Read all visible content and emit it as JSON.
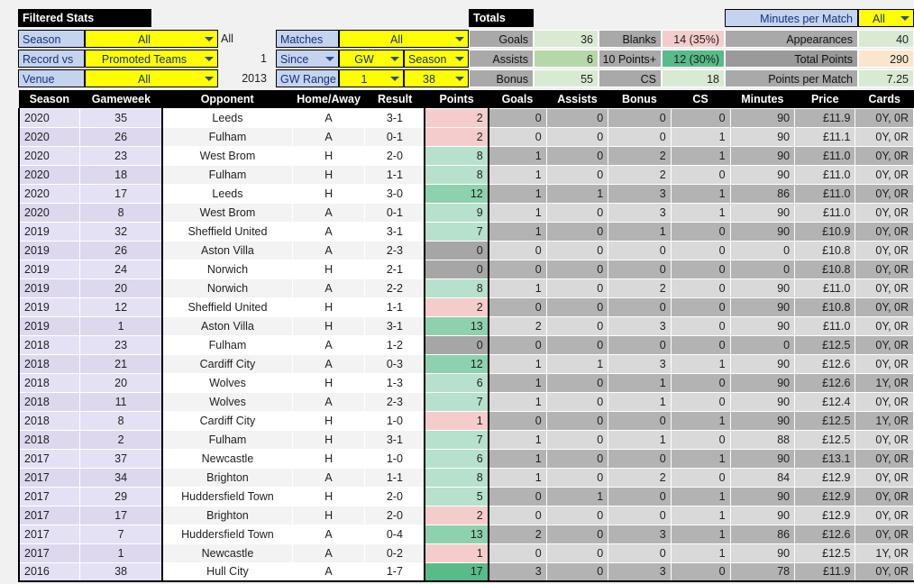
{
  "filters": {
    "title": "Filtered Stats",
    "rows": [
      {
        "label": "Season",
        "value": "All",
        "side": "All"
      },
      {
        "label": "Record vs",
        "value": "Promoted Teams",
        "side": "1"
      },
      {
        "label": "Venue",
        "value": "All",
        "side": "2013"
      }
    ]
  },
  "matches": {
    "rows": [
      {
        "label": "Matches",
        "v1": "All",
        "v2": null
      },
      {
        "label": "Since",
        "v1": "GW",
        "v2": "Season",
        "label_has_caret": true
      },
      {
        "label": "GW Range",
        "v1": "1",
        "v2": "38"
      }
    ]
  },
  "totals": {
    "title": "Totals",
    "left": [
      {
        "label": "Goals",
        "value": "36"
      },
      {
        "label": "Assists",
        "value": "6"
      },
      {
        "label": "Bonus",
        "value": "55"
      }
    ],
    "right": [
      {
        "label": "Blanks",
        "value": "14 (35%)"
      },
      {
        "label": "10 Points+",
        "value": "12 (30%)"
      },
      {
        "label": "CS",
        "value": "18"
      }
    ]
  },
  "summary": {
    "dropdown_label": "Minutes per Match",
    "dropdown_value": "All",
    "rows": [
      {
        "label": "Appearances",
        "value": "40"
      },
      {
        "label": "Total Points",
        "value": "290"
      },
      {
        "label": "Points per Match",
        "value": "7.25"
      }
    ]
  },
  "table": {
    "columns": [
      "Season",
      "Gameweek",
      "Opponent",
      "Home/Away",
      "Result",
      "Points",
      "Goals",
      "Assists",
      "Bonus",
      "CS",
      "Minutes",
      "Price",
      "Cards"
    ],
    "rows": [
      {
        "season": "2020",
        "gameweek": "35",
        "opponent": "Leeds",
        "home_away": "A",
        "result": "3-1",
        "points": "2",
        "points_tier": "low",
        "goals": "0",
        "assists": "0",
        "bonus": "0",
        "cs": "0",
        "minutes": "90",
        "price": "£11.9",
        "cards": "0Y, 0R"
      },
      {
        "season": "2020",
        "gameweek": "26",
        "opponent": "Fulham",
        "home_away": "A",
        "result": "0-1",
        "points": "2",
        "points_tier": "low",
        "goals": "0",
        "assists": "0",
        "bonus": "0",
        "cs": "1",
        "minutes": "90",
        "price": "£11.1",
        "cards": "0Y, 0R"
      },
      {
        "season": "2020",
        "gameweek": "23",
        "opponent": "West Brom",
        "home_away": "H",
        "result": "2-0",
        "points": "8",
        "points_tier": "mid",
        "goals": "1",
        "assists": "0",
        "bonus": "2",
        "cs": "1",
        "minutes": "90",
        "price": "£11.0",
        "cards": "0Y, 0R"
      },
      {
        "season": "2020",
        "gameweek": "18",
        "opponent": "Fulham",
        "home_away": "H",
        "result": "1-1",
        "points": "8",
        "points_tier": "mid",
        "goals": "1",
        "assists": "0",
        "bonus": "2",
        "cs": "0",
        "minutes": "90",
        "price": "£11.0",
        "cards": "0Y, 0R"
      },
      {
        "season": "2020",
        "gameweek": "17",
        "opponent": "Leeds",
        "home_away": "H",
        "result": "3-0",
        "points": "12",
        "points_tier": "hi",
        "goals": "1",
        "assists": "1",
        "bonus": "3",
        "cs": "1",
        "minutes": "86",
        "price": "£11.0",
        "cards": "0Y, 0R"
      },
      {
        "season": "2020",
        "gameweek": "8",
        "opponent": "West Brom",
        "home_away": "A",
        "result": "0-1",
        "points": "9",
        "points_tier": "mid",
        "goals": "1",
        "assists": "0",
        "bonus": "3",
        "cs": "1",
        "minutes": "90",
        "price": "£11.0",
        "cards": "0Y, 0R"
      },
      {
        "season": "2019",
        "gameweek": "32",
        "opponent": "Sheffield United",
        "home_away": "A",
        "result": "3-1",
        "points": "7",
        "points_tier": "mid",
        "goals": "1",
        "assists": "0",
        "bonus": "1",
        "cs": "0",
        "minutes": "90",
        "price": "£10.9",
        "cards": "0Y, 0R"
      },
      {
        "season": "2019",
        "gameweek": "26",
        "opponent": "Aston Villa",
        "home_away": "A",
        "result": "2-3",
        "points": "0",
        "points_tier": "zero",
        "goals": "0",
        "assists": "0",
        "bonus": "0",
        "cs": "0",
        "minutes": "0",
        "price": "£10.8",
        "cards": "0Y, 0R"
      },
      {
        "season": "2019",
        "gameweek": "24",
        "opponent": "Norwich",
        "home_away": "H",
        "result": "2-1",
        "points": "0",
        "points_tier": "zero",
        "goals": "0",
        "assists": "0",
        "bonus": "0",
        "cs": "0",
        "minutes": "0",
        "price": "£10.8",
        "cards": "0Y, 0R"
      },
      {
        "season": "2019",
        "gameweek": "20",
        "opponent": "Norwich",
        "home_away": "A",
        "result": "2-2",
        "points": "8",
        "points_tier": "mid",
        "goals": "1",
        "assists": "0",
        "bonus": "2",
        "cs": "0",
        "minutes": "90",
        "price": "£11.0",
        "cards": "0Y, 0R"
      },
      {
        "season": "2019",
        "gameweek": "12",
        "opponent": "Sheffield United",
        "home_away": "H",
        "result": "1-1",
        "points": "2",
        "points_tier": "low",
        "goals": "0",
        "assists": "0",
        "bonus": "0",
        "cs": "0",
        "minutes": "90",
        "price": "£10.8",
        "cards": "0Y, 0R"
      },
      {
        "season": "2019",
        "gameweek": "1",
        "opponent": "Aston Villa",
        "home_away": "H",
        "result": "3-1",
        "points": "13",
        "points_tier": "hi",
        "goals": "2",
        "assists": "0",
        "bonus": "3",
        "cs": "0",
        "minutes": "90",
        "price": "£11.0",
        "cards": "0Y, 0R"
      },
      {
        "season": "2018",
        "gameweek": "23",
        "opponent": "Fulham",
        "home_away": "A",
        "result": "1-2",
        "points": "0",
        "points_tier": "zero",
        "goals": "0",
        "assists": "0",
        "bonus": "0",
        "cs": "0",
        "minutes": "0",
        "price": "£12.5",
        "cards": "0Y, 0R"
      },
      {
        "season": "2018",
        "gameweek": "21",
        "opponent": "Cardiff City",
        "home_away": "A",
        "result": "0-3",
        "points": "12",
        "points_tier": "hi",
        "goals": "1",
        "assists": "1",
        "bonus": "3",
        "cs": "1",
        "minutes": "90",
        "price": "£12.6",
        "cards": "0Y, 0R"
      },
      {
        "season": "2018",
        "gameweek": "20",
        "opponent": "Wolves",
        "home_away": "H",
        "result": "1-3",
        "points": "6",
        "points_tier": "mid",
        "goals": "1",
        "assists": "0",
        "bonus": "1",
        "cs": "0",
        "minutes": "90",
        "price": "£12.6",
        "cards": "1Y, 0R"
      },
      {
        "season": "2018",
        "gameweek": "11",
        "opponent": "Wolves",
        "home_away": "A",
        "result": "2-3",
        "points": "7",
        "points_tier": "mid",
        "goals": "1",
        "assists": "0",
        "bonus": "1",
        "cs": "0",
        "minutes": "90",
        "price": "£12.4",
        "cards": "0Y, 0R"
      },
      {
        "season": "2018",
        "gameweek": "8",
        "opponent": "Cardiff City",
        "home_away": "H",
        "result": "1-0",
        "points": "1",
        "points_tier": "low",
        "goals": "0",
        "assists": "0",
        "bonus": "0",
        "cs": "1",
        "minutes": "90",
        "price": "£12.5",
        "cards": "1Y, 0R"
      },
      {
        "season": "2018",
        "gameweek": "2",
        "opponent": "Fulham",
        "home_away": "H",
        "result": "3-1",
        "points": "7",
        "points_tier": "mid",
        "goals": "1",
        "assists": "0",
        "bonus": "1",
        "cs": "0",
        "minutes": "88",
        "price": "£12.5",
        "cards": "0Y, 0R"
      },
      {
        "season": "2017",
        "gameweek": "37",
        "opponent": "Newcastle",
        "home_away": "H",
        "result": "1-0",
        "points": "6",
        "points_tier": "mid",
        "goals": "1",
        "assists": "0",
        "bonus": "0",
        "cs": "1",
        "minutes": "90",
        "price": "£13.1",
        "cards": "0Y, 0R"
      },
      {
        "season": "2017",
        "gameweek": "34",
        "opponent": "Brighton",
        "home_away": "A",
        "result": "1-1",
        "points": "8",
        "points_tier": "mid",
        "goals": "1",
        "assists": "0",
        "bonus": "2",
        "cs": "0",
        "minutes": "84",
        "price": "£12.9",
        "cards": "0Y, 0R"
      },
      {
        "season": "2017",
        "gameweek": "29",
        "opponent": "Huddersfield Town",
        "home_away": "H",
        "result": "2-0",
        "points": "5",
        "points_tier": "lowmid",
        "goals": "0",
        "assists": "1",
        "bonus": "0",
        "cs": "1",
        "minutes": "90",
        "price": "£12.9",
        "cards": "0Y, 0R"
      },
      {
        "season": "2017",
        "gameweek": "17",
        "opponent": "Brighton",
        "home_away": "H",
        "result": "2-0",
        "points": "2",
        "points_tier": "low",
        "goals": "0",
        "assists": "0",
        "bonus": "0",
        "cs": "1",
        "minutes": "90",
        "price": "£12.9",
        "cards": "0Y, 0R"
      },
      {
        "season": "2017",
        "gameweek": "7",
        "opponent": "Huddersfield Town",
        "home_away": "A",
        "result": "0-4",
        "points": "13",
        "points_tier": "hi",
        "goals": "2",
        "assists": "0",
        "bonus": "3",
        "cs": "1",
        "minutes": "86",
        "price": "£12.6",
        "cards": "0Y, 0R"
      },
      {
        "season": "2017",
        "gameweek": "1",
        "opponent": "Newcastle",
        "home_away": "A",
        "result": "0-2",
        "points": "1",
        "points_tier": "low",
        "goals": "0",
        "assists": "0",
        "bonus": "0",
        "cs": "1",
        "minutes": "90",
        "price": "£12.5",
        "cards": "1Y, 0R"
      },
      {
        "season": "2016",
        "gameweek": "38",
        "opponent": "Hull City",
        "home_away": "A",
        "result": "1-7",
        "points": "17",
        "points_tier": "top",
        "goals": "3",
        "assists": "0",
        "bonus": "3",
        "cs": "0",
        "minutes": "78",
        "price": "£11.9",
        "cards": "0Y, 0R"
      }
    ]
  },
  "colors": {
    "accent_yellow": "#ffff00",
    "label_blue": "#c5d3ef",
    "header_black": "#000000",
    "green_strong": "#57bb8a",
    "red_light": "#f4cccc",
    "orange_light": "#fce5cd"
  }
}
